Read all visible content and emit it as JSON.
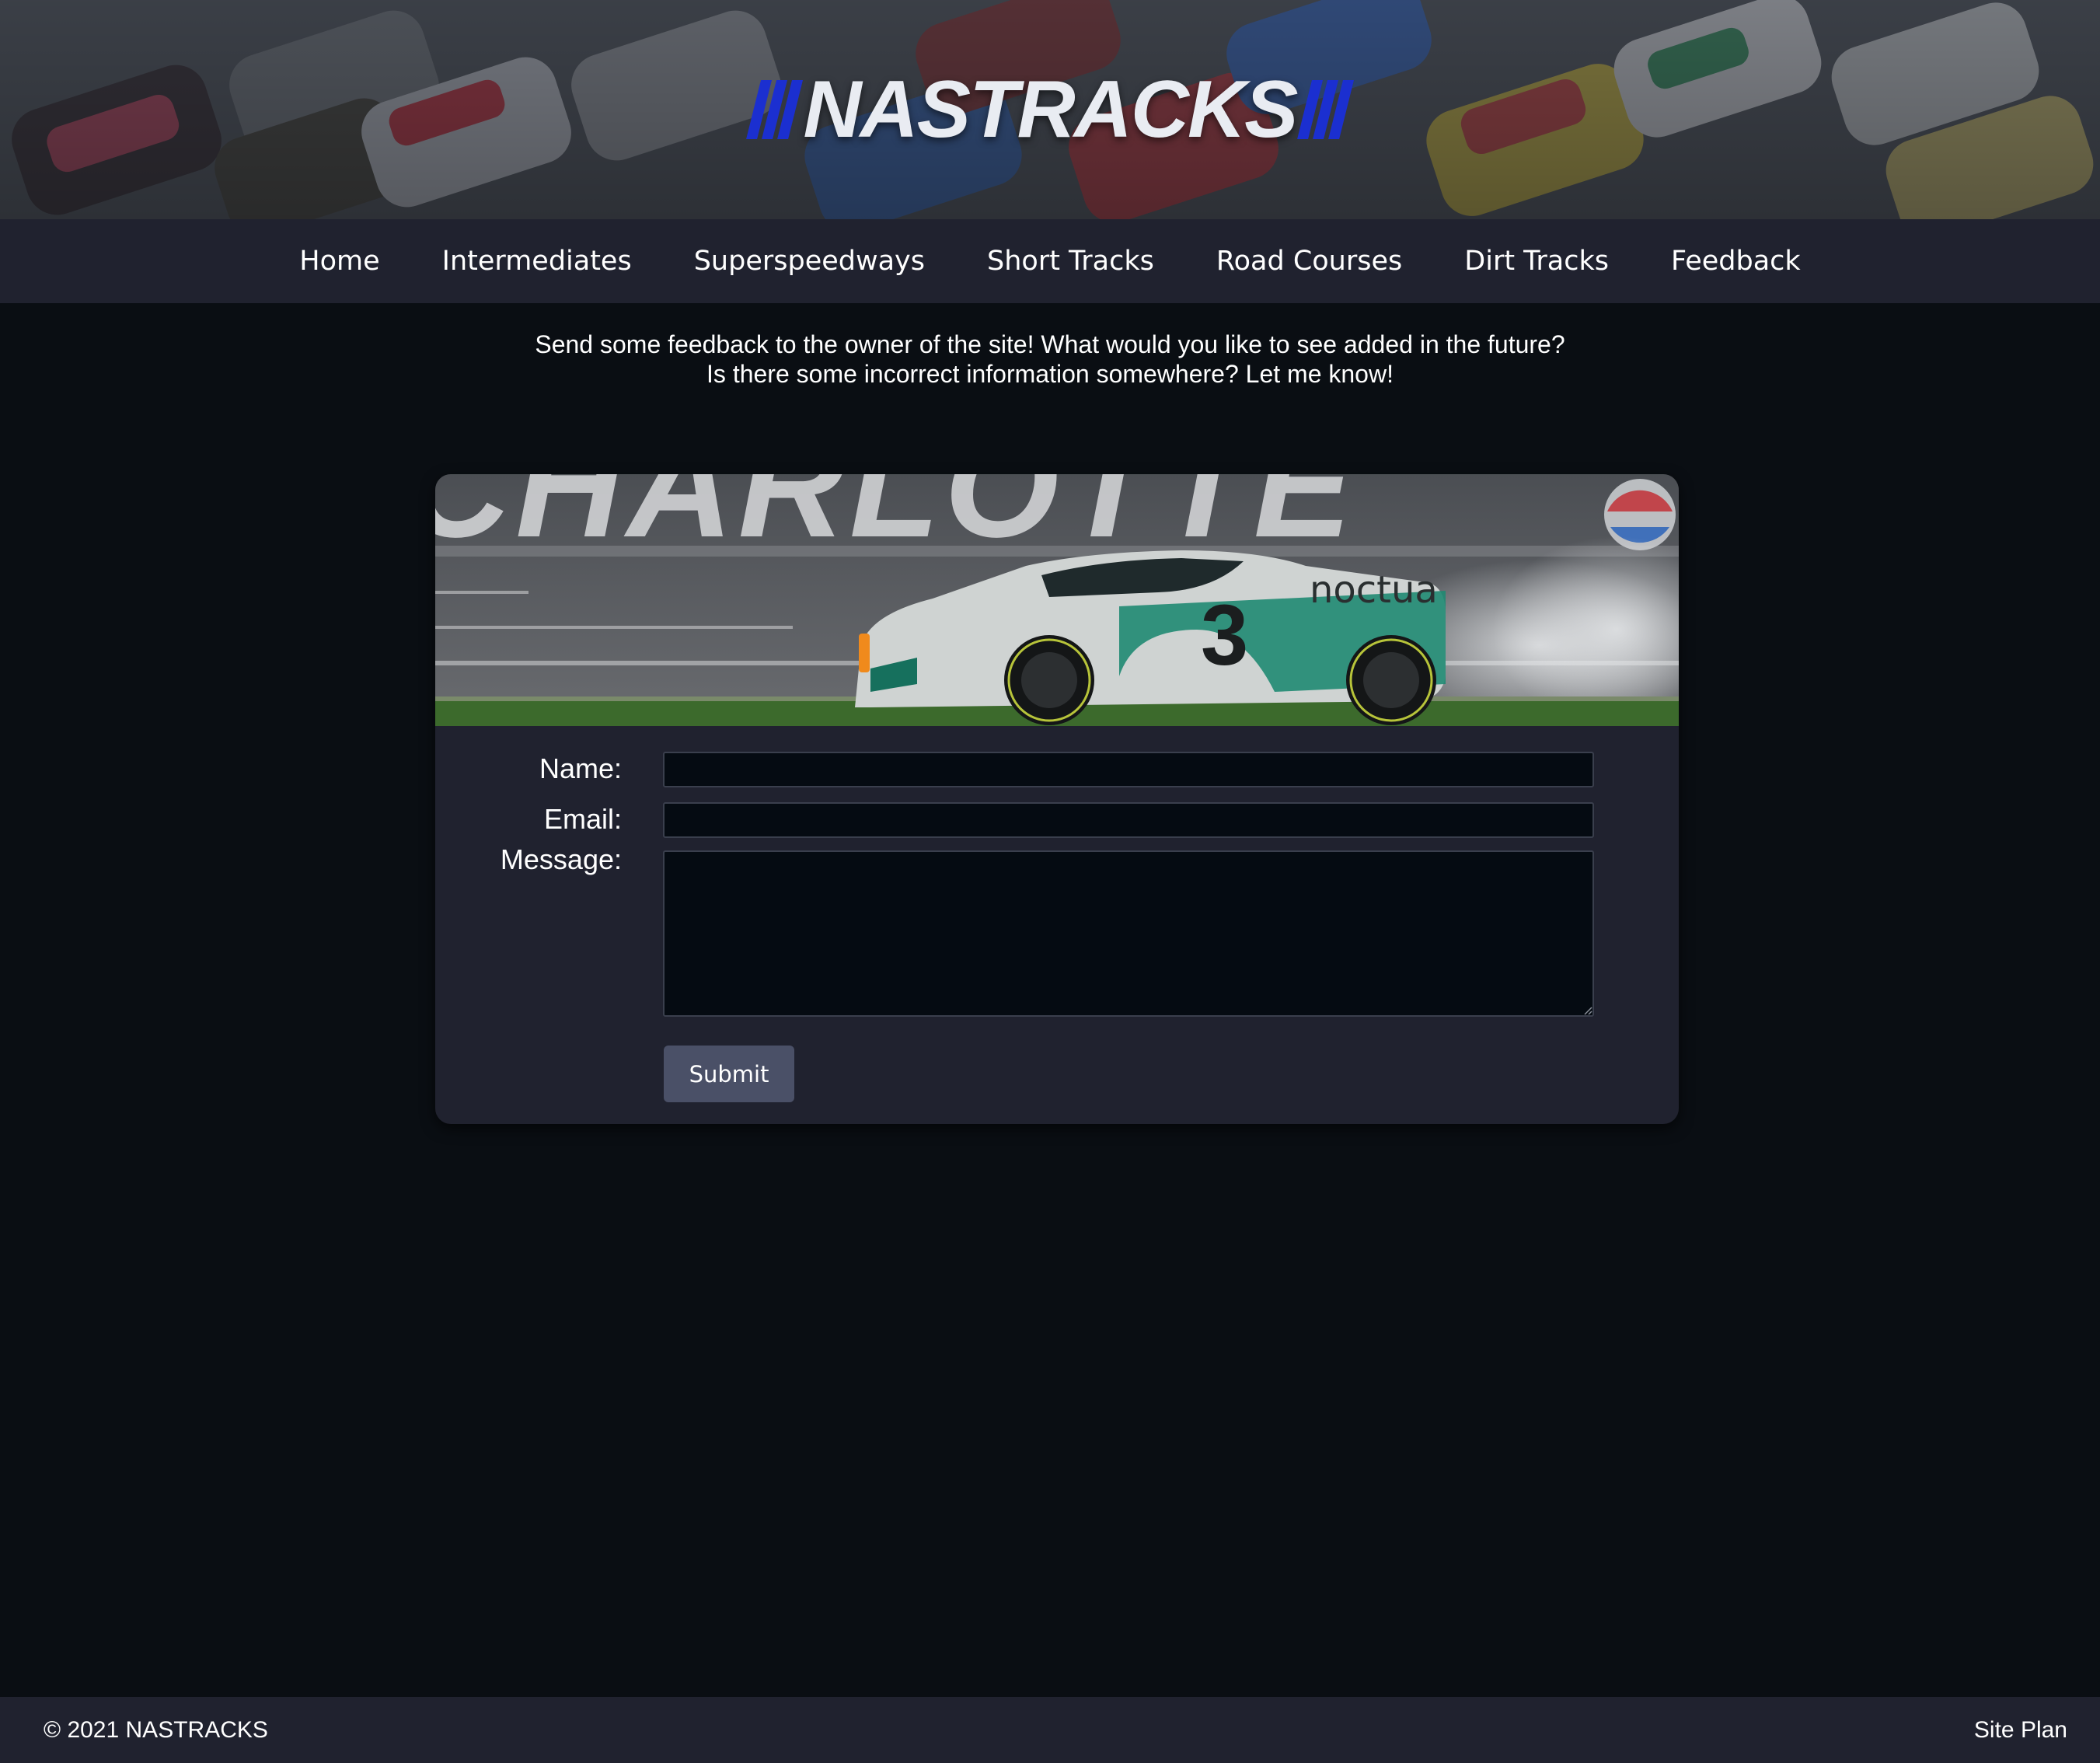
{
  "brand": {
    "name": "NASTRACKS",
    "accent_color": "#1b2fd0"
  },
  "nav": {
    "items": [
      {
        "label": "Home"
      },
      {
        "label": "Intermediates"
      },
      {
        "label": "Superspeedways"
      },
      {
        "label": "Short Tracks"
      },
      {
        "label": "Road Courses"
      },
      {
        "label": "Dirt Tracks"
      },
      {
        "label": "Feedback"
      }
    ]
  },
  "intro": {
    "line1": "Send some feedback to the owner of the site! What would you like to see added in the future?",
    "line2": "Is there some incorrect information somewhere? Let me know!"
  },
  "form": {
    "hero_car_number": "3",
    "hero_sponsor": "noctua",
    "hero_track_text": "CHARLOTTE",
    "name_label": "Name:",
    "name_value": "",
    "email_label": "Email:",
    "email_value": "",
    "message_label": "Message:",
    "message_value": "",
    "submit_label": "Submit"
  },
  "footer": {
    "copyright": "© 2021 NASTRACKS",
    "site_plan": "Site Plan"
  },
  "colors": {
    "page_bg": "#0a0e13",
    "panel_bg": "#20222f",
    "input_bg": "#050b12",
    "button_bg": "#4a5067"
  }
}
